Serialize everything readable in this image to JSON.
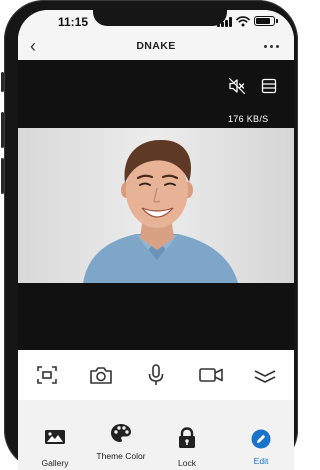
{
  "status_bar": {
    "time": "11:15"
  },
  "nav": {
    "title": "DNAKE"
  },
  "video": {
    "data_rate": "176 KB/S"
  },
  "toolbar": {
    "icons": [
      "screenshot-icon",
      "camera-icon",
      "microphone-icon",
      "video-record-icon",
      "collapse-icon"
    ]
  },
  "menu": {
    "items": [
      {
        "label": "Gallery",
        "icon": "gallery-icon"
      },
      {
        "label": "Theme Color",
        "icon": "palette-icon"
      },
      {
        "label": "Lock",
        "icon": "lock-icon"
      },
      {
        "label": "Edit",
        "icon": "edit-icon",
        "active": true
      }
    ],
    "active_color": "#1a73c8"
  }
}
